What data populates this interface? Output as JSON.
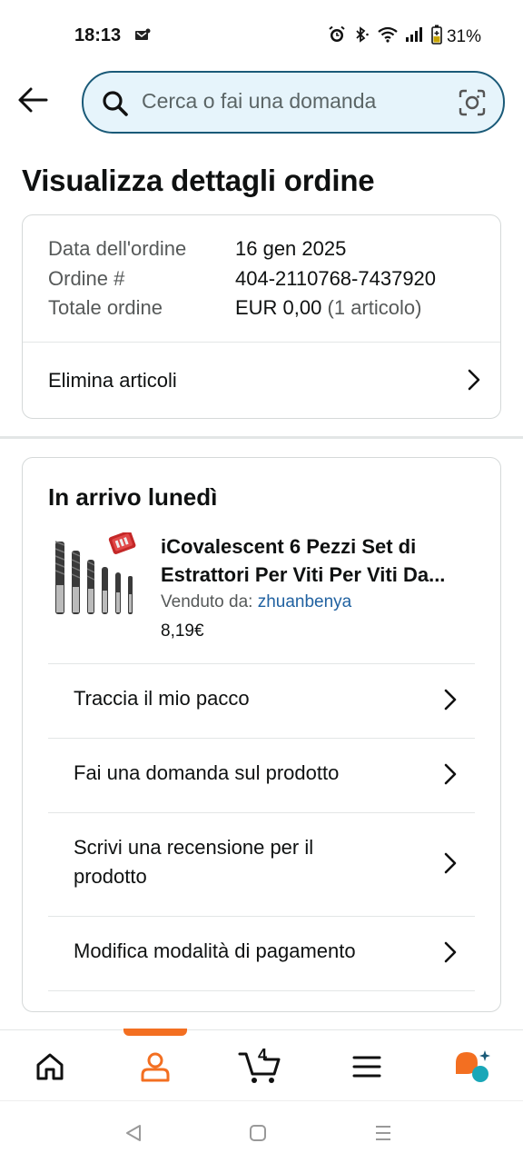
{
  "status_bar": {
    "time": "18:13",
    "battery": "31%",
    "icons": [
      "notification-icon",
      "alarm-icon",
      "bluetooth-icon",
      "wifi-icon",
      "signal-icon",
      "battery-icon"
    ]
  },
  "header": {
    "search_placeholder": "Cerca o fai una domanda"
  },
  "page_title": "Visualizza dettagli ordine",
  "order": {
    "date_label": "Data dell'ordine",
    "date_value": "16 gen 2025",
    "number_label": "Ordine #",
    "number_value": "404-2110768-7437920",
    "total_label": "Totale ordine",
    "total_value": "EUR 0,00",
    "total_items": "(1 articolo)",
    "delete_items_label": "Elimina articoli"
  },
  "delivery": {
    "title": "In arrivo lunedì",
    "product": {
      "title_line1": "iCovalescent 6 Pezzi Set di",
      "title_line2": "Estrattori Per Viti Per Viti Da...",
      "seller_label": "Venduto da:",
      "seller_name": "zhuanbenya",
      "price": "8,19€"
    },
    "actions": [
      {
        "label": "Traccia il mio pacco"
      },
      {
        "label": "Fai una domanda sul prodotto"
      },
      {
        "label": "Scrivi una recensione per il prodotto"
      },
      {
        "label": "Modifica modalità di pagamento"
      }
    ]
  },
  "bottom_nav": {
    "cart_count": "4",
    "active_color": "#f36f21",
    "items": [
      "home-icon",
      "account-icon",
      "cart-icon",
      "menu-icon",
      "rufus-icon"
    ]
  },
  "colors": {
    "search_border": "#1a5a78",
    "search_bg": "#e6f4fb",
    "link": "#2162a1",
    "accent": "#f36f21"
  }
}
